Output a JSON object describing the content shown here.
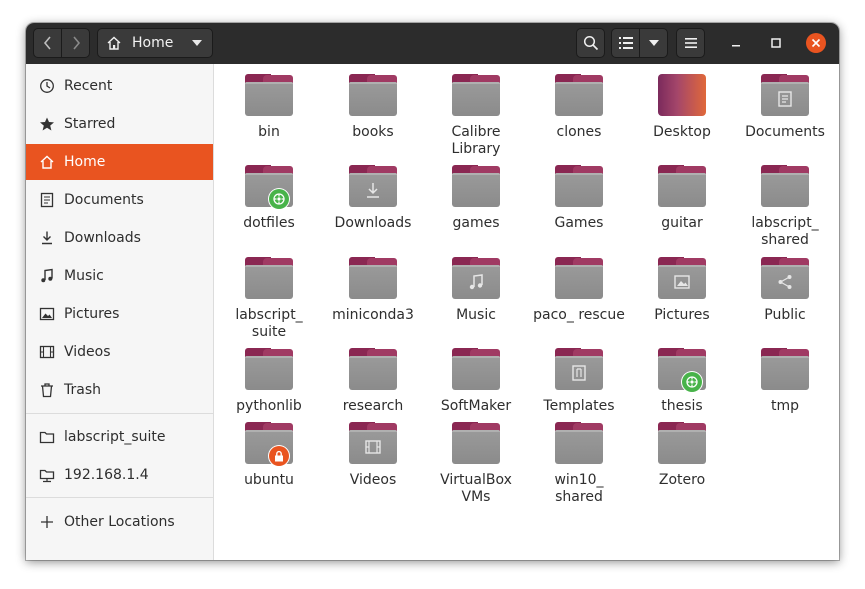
{
  "header": {
    "back_icon": "chevron-left-icon",
    "forward_icon": "chevron-right-icon",
    "location_label": "Home",
    "location_icon": "home-icon",
    "search_icon": "search-icon",
    "view_icon": "list-view-icon",
    "view_menu_icon": "chevron-down-icon",
    "menu_icon": "hamburger-icon",
    "close_color": "#e95420"
  },
  "sidebar": {
    "accent": "#e95420",
    "items": [
      {
        "label": "Recent",
        "icon": "clock-icon"
      },
      {
        "label": "Starred",
        "icon": "star-icon"
      },
      {
        "label": "Home",
        "icon": "home-icon",
        "active": true
      },
      {
        "label": "Documents",
        "icon": "document-icon"
      },
      {
        "label": "Downloads",
        "icon": "download-icon"
      },
      {
        "label": "Music",
        "icon": "music-icon"
      },
      {
        "label": "Pictures",
        "icon": "picture-icon"
      },
      {
        "label": "Videos",
        "icon": "film-icon"
      },
      {
        "label": "Trash",
        "icon": "trash-icon"
      },
      {
        "label": "labscript_suite",
        "icon": "folder-icon"
      },
      {
        "label": "192.168.1.4",
        "icon": "network-drive-icon"
      },
      {
        "label": "Other Locations",
        "icon": "plus-icon"
      }
    ]
  },
  "files": [
    {
      "name": "bin"
    },
    {
      "name": "books"
    },
    {
      "name": "Calibre Library"
    },
    {
      "name": "clones"
    },
    {
      "name": "Desktop",
      "icon": "desktop-icon"
    },
    {
      "name": "Documents",
      "icon": "document-icon"
    },
    {
      "name": "dotfiles",
      "badge": "emblem-synced-icon"
    },
    {
      "name": "Downloads",
      "icon": "download-icon"
    },
    {
      "name": "games"
    },
    {
      "name": "Games"
    },
    {
      "name": "guitar"
    },
    {
      "name": "labscript_ shared"
    },
    {
      "name": "labscript_ suite"
    },
    {
      "name": "miniconda3"
    },
    {
      "name": "Music",
      "icon": "music-icon"
    },
    {
      "name": "paco_ rescue"
    },
    {
      "name": "Pictures",
      "icon": "picture-icon"
    },
    {
      "name": "Public",
      "icon": "share-icon"
    },
    {
      "name": "pythonlib"
    },
    {
      "name": "research"
    },
    {
      "name": "SoftMaker"
    },
    {
      "name": "Templates",
      "icon": "template-icon"
    },
    {
      "name": "thesis",
      "badge": "emblem-synced-icon"
    },
    {
      "name": "tmp"
    },
    {
      "name": "ubuntu",
      "badge": "lock-icon"
    },
    {
      "name": "Videos",
      "icon": "film-icon"
    },
    {
      "name": "VirtualBox VMs"
    },
    {
      "name": "win10_ shared"
    },
    {
      "name": "Zotero"
    }
  ]
}
